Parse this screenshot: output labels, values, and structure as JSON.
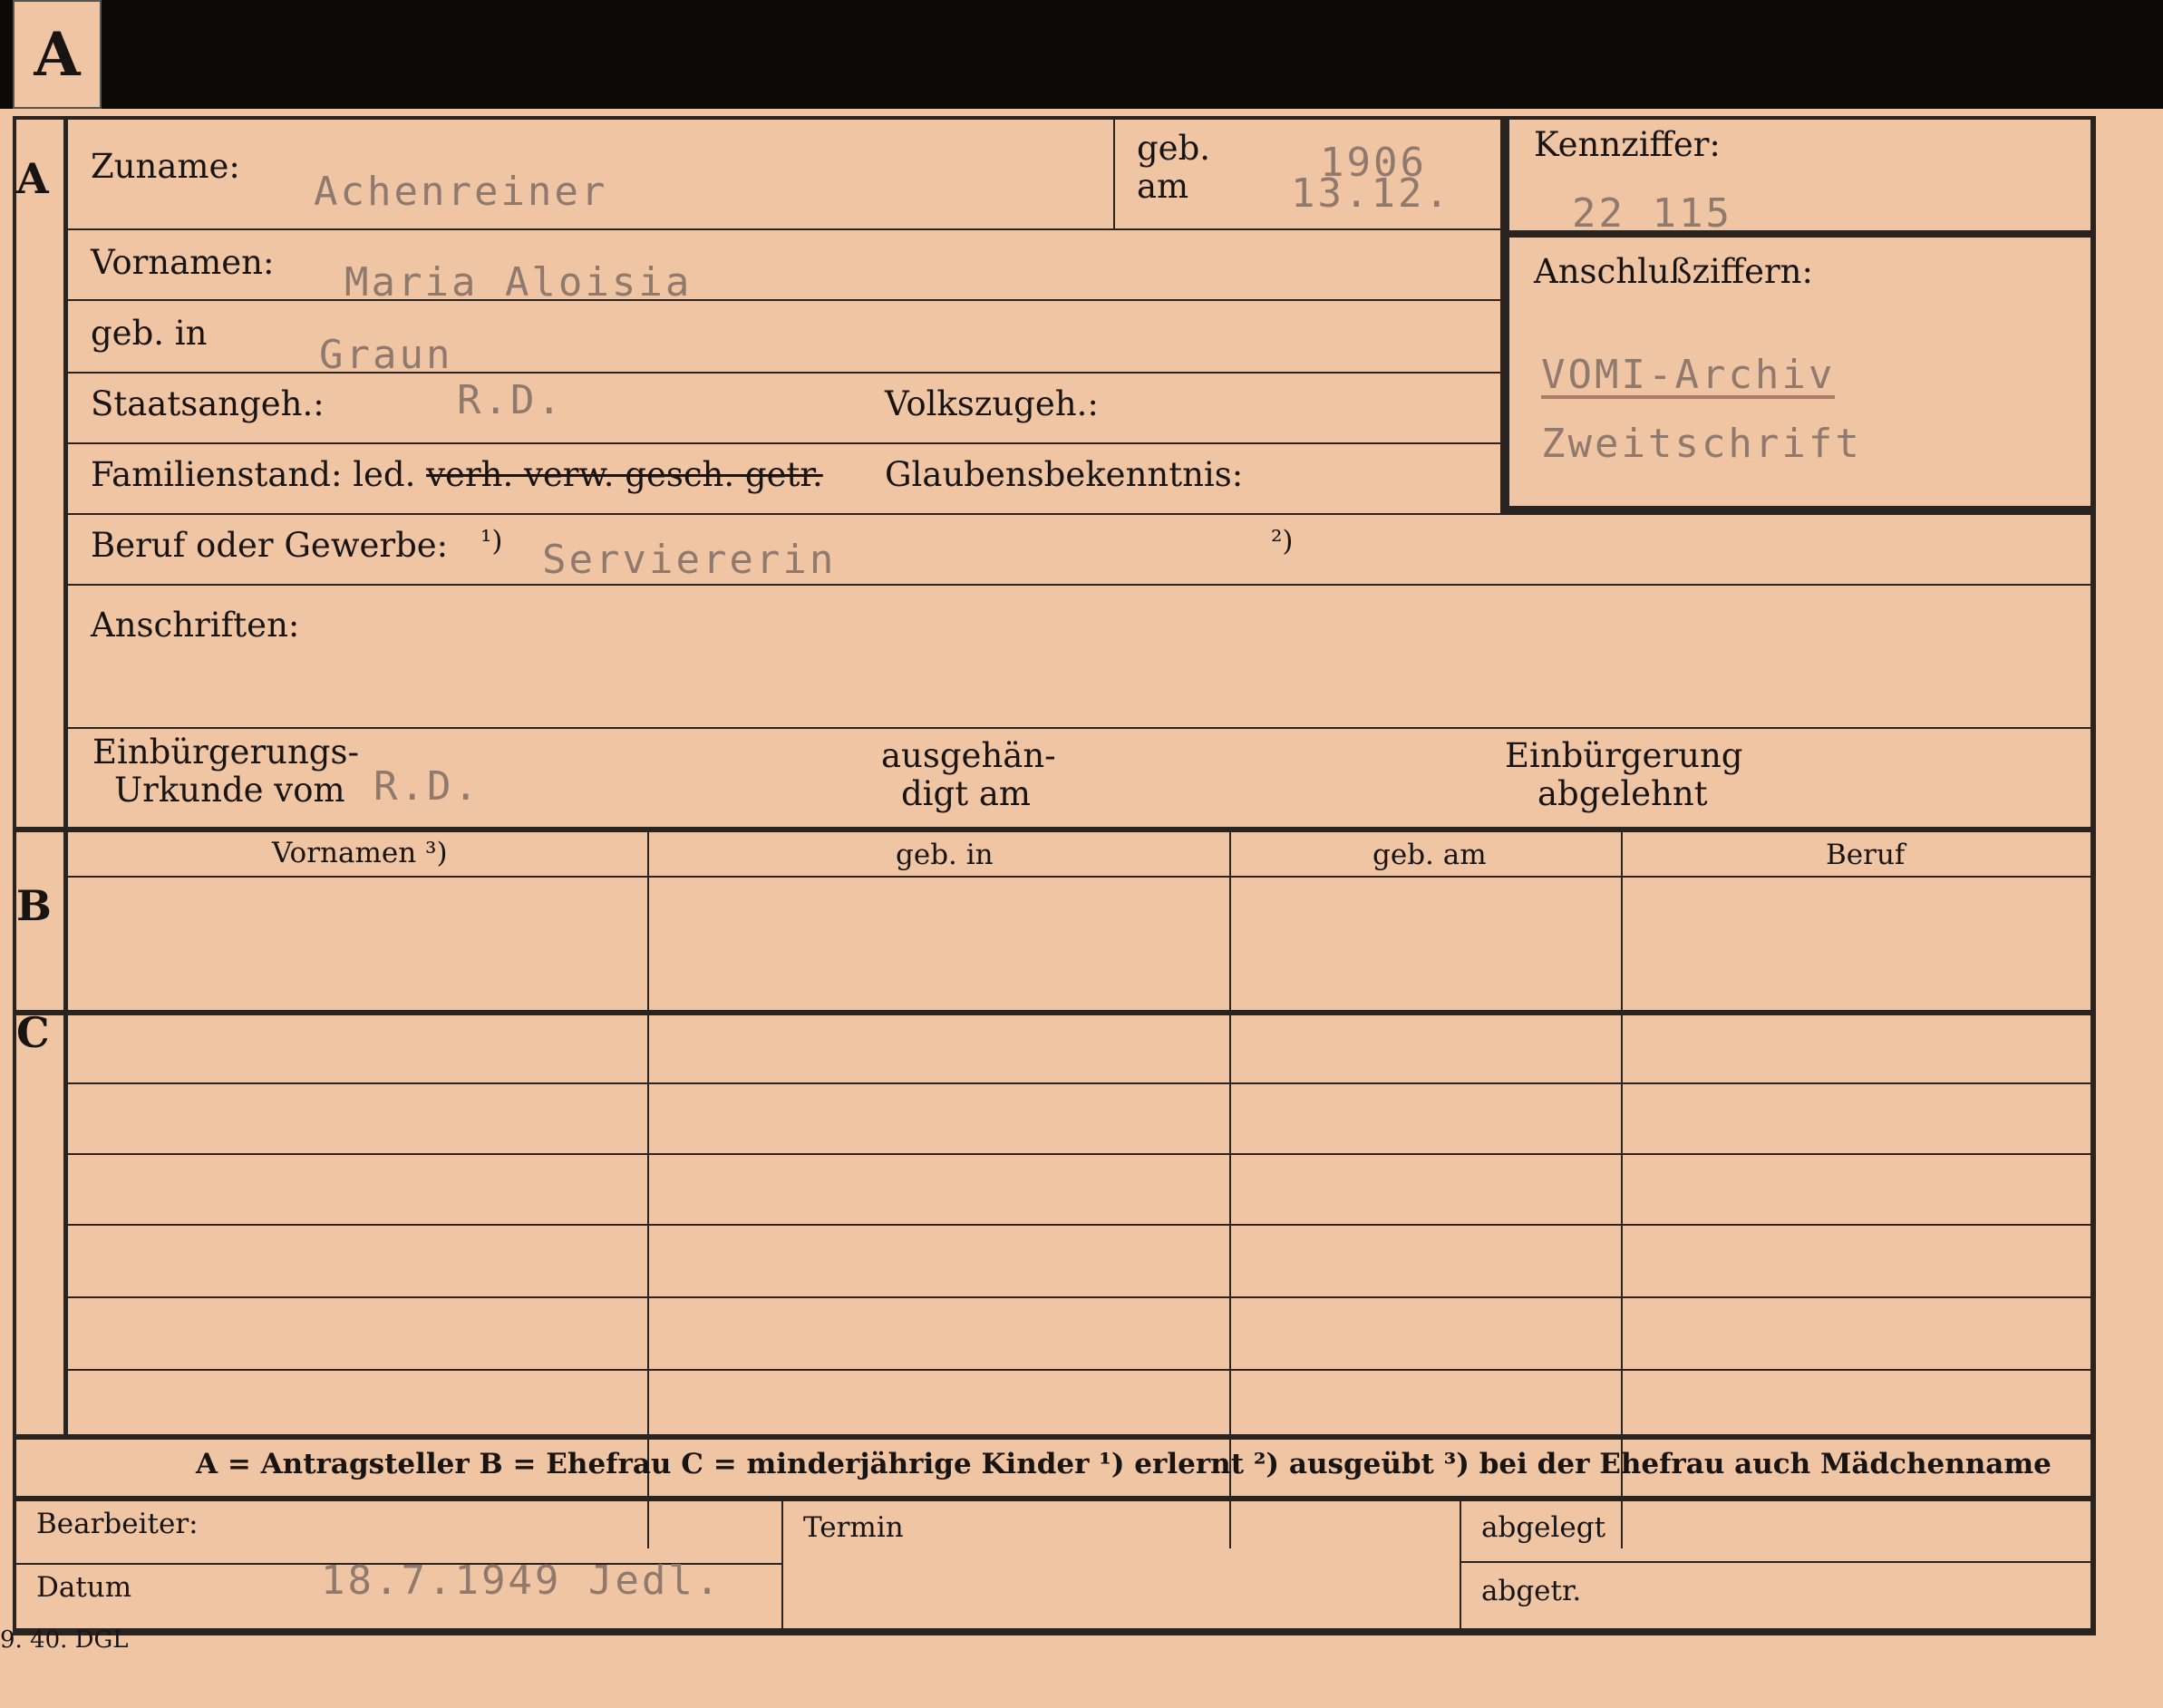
{
  "tab_letter": "A",
  "section_labels": {
    "a": "A",
    "b": "B",
    "c": "C"
  },
  "section_a": {
    "zuname_label": "Zuname:",
    "zuname_value": "Achenreiner",
    "geb_am_label_1": "geb.",
    "geb_am_label_2": "am",
    "geb_year": "1906",
    "geb_day_month": "13.12.",
    "vornamen_label": "Vornamen:",
    "vornamen_value": "Maria Aloisia",
    "geb_in_label": "geb. in",
    "geb_in_value": "Graun",
    "staatsangeh_label": "Staatsangeh.:",
    "staatsangeh_value": "R.D.",
    "volkszugeh_label": "Volkszugeh.:",
    "familienstand_label": "Familienstand: led.",
    "familienstand_struck": "verh. verw. gesch. getr.",
    "glaubens_label": "Glaubensbekenntnis:",
    "beruf_label": "Beruf oder Gewerbe:",
    "beruf_mark1": "¹)",
    "beruf_value": "Serviererin",
    "beruf_mark2": "²)",
    "anschriften_label": "Anschriften:",
    "einb_urkunde_label_1": "Einbürgerungs-",
    "einb_urkunde_label_2": "Urkunde vom",
    "einb_urkunde_value": "R.D.",
    "ausgehaendigt_label_1": "ausgehän-",
    "ausgehaendigt_label_2": "digt am",
    "einb_abgelehnt_label_1": "Einbürgerung",
    "einb_abgelehnt_label_2": "abgelehnt"
  },
  "kennziffer": {
    "label": "Kennziffer:",
    "value": "22 115",
    "anschluss_label": "Anschlußziffern:",
    "anschluss_line1": "VOMI-Archiv",
    "anschluss_line2": "Zweitschrift"
  },
  "table": {
    "headers": [
      "Vornamen ³)",
      "geb. in",
      "geb. am",
      "Beruf"
    ]
  },
  "legend": "A = Antragsteller   B = Ehefrau   C = minderjährige Kinder   ¹) erlernt   ²) ausgeübt   ³) bei der Ehefrau auch Mädchenname",
  "bottom": {
    "bearbeiter_label": "Bearbeiter:",
    "datum_label": "Datum",
    "datum_value": "18.7.1949 Jedl.",
    "termin_label": "Termin",
    "abgelegt_label": "abgelegt",
    "abgetr_label": "abgetr."
  },
  "footer_print": "9. 40. DGL"
}
